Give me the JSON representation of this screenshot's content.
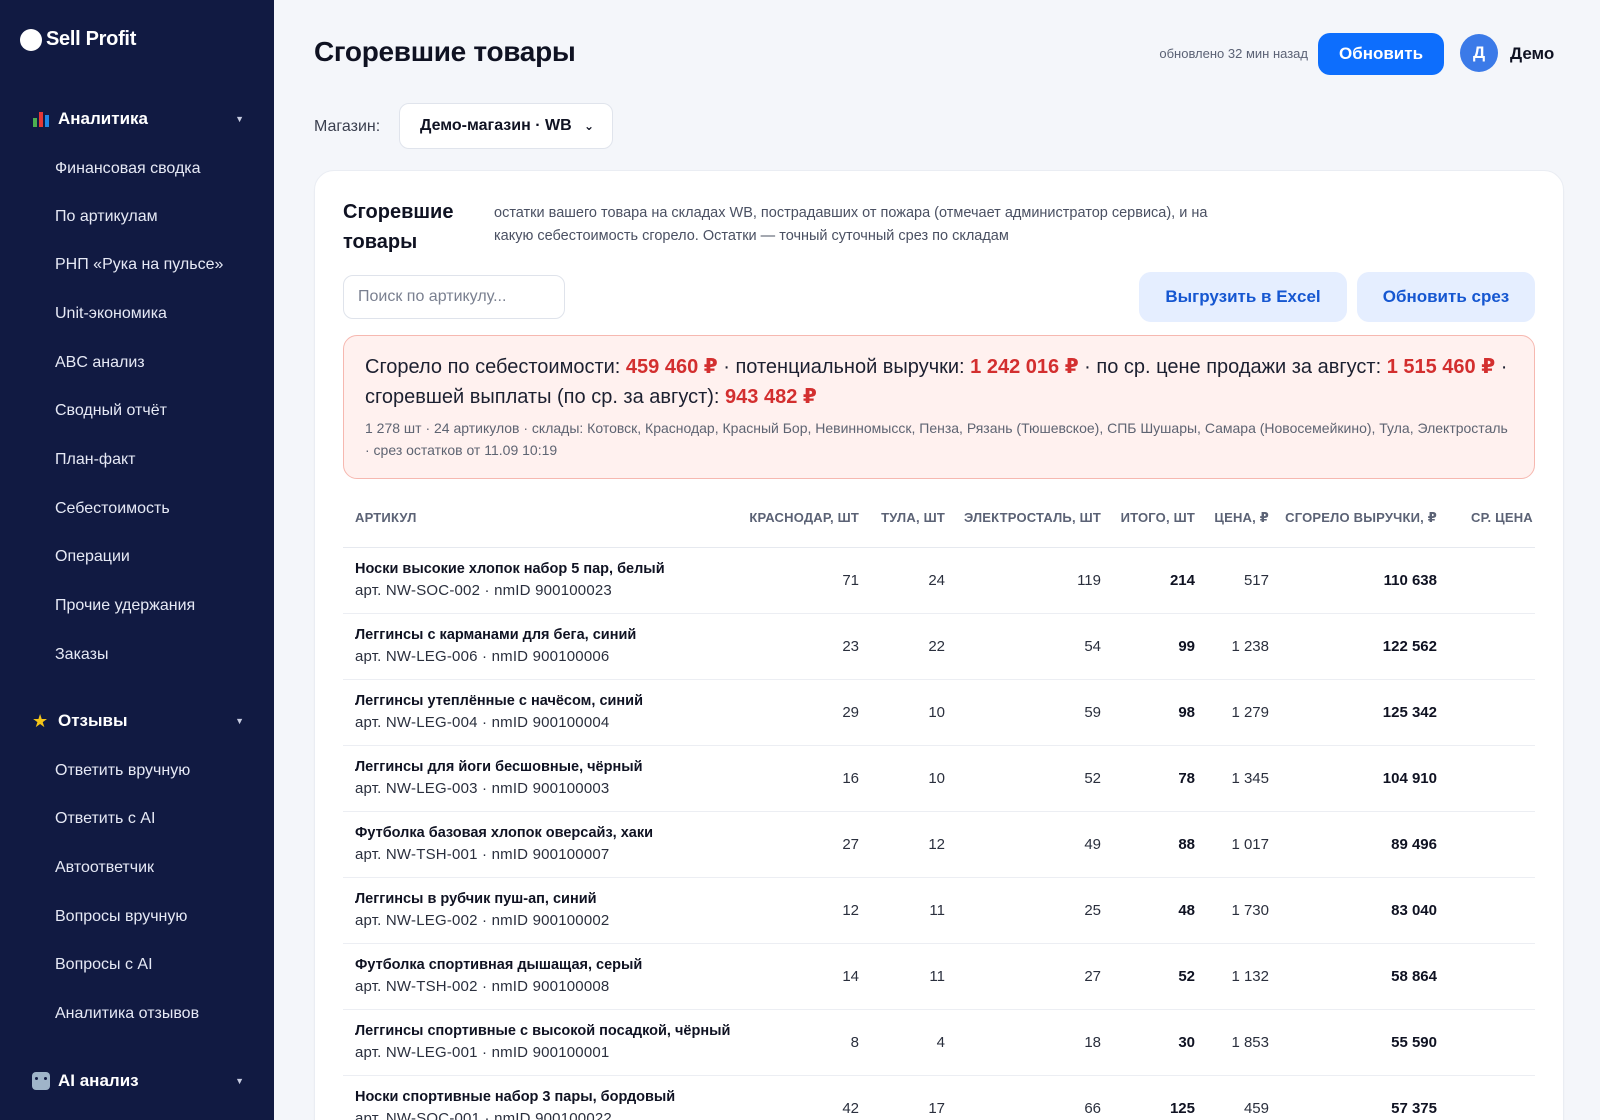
{
  "brand": {
    "name": "Sell Profit"
  },
  "sidebar": {
    "sections": [
      {
        "label": "Аналитика",
        "icon": "bar-chart-icon",
        "items": [
          "Финансовая сводка",
          "По артикулам",
          "РНП «Рука на пульсе»",
          "Unit-экономика",
          "ABC анализ",
          "Сводный отчёт",
          "План-факт",
          "Себестоимость",
          "Операции",
          "Прочие удержания",
          "Заказы"
        ]
      },
      {
        "label": "Отзывы",
        "icon": "star-icon",
        "items": [
          "Ответить вручную",
          "Ответить с AI",
          "Автоответчик",
          "Вопросы вручную",
          "Вопросы с AI",
          "Аналитика отзывов"
        ]
      },
      {
        "label": "AI анализ",
        "icon": "robot-icon",
        "items": []
      }
    ]
  },
  "header": {
    "title": "Сгоревшие товары",
    "updated": "обновлено 32 мин назад",
    "refresh_label": "Обновить",
    "avatar_letter": "Д",
    "user_name": "Демо",
    "accent_color": "#0d6efd"
  },
  "store": {
    "label": "Магазин:",
    "selected": "Демо-магазин · WB"
  },
  "card": {
    "title": "Сгоревшие товары",
    "description": "остатки вашего товара на складах WB, пострадавших от пожара (отмечает администратор сервиса), и на какую себестоимость сгорело. Остатки — точный суточный срез по складам",
    "search_placeholder": "Поиск по артикулу...",
    "excel_label": "Выгрузить в Excel",
    "slice_label": "Обновить срез"
  },
  "summary": {
    "cost_label": "Сгорело по себестоимости: ",
    "cost_value": "459 460 ₽",
    "revenue_label": " · потенциальной выручки: ",
    "revenue_value": "1 242 016 ₽",
    "avg_price_label": " · по ср. цене продажи за август: ",
    "avg_price_value": "1 515 460 ₽",
    "payout_label": " · сгоревшей выплаты (по ср. за август): ",
    "payout_value": "943 482 ₽",
    "meta": "1 278 шт · 24 артикулов · склады: Котовск, Краснодар, Красный Бор, Невинномысск, Пенза, Рязань (Тюшевское), СПБ Шушары, Самара (Новосемейкино), Тула, Электросталь · срез остатков от 11.09 10:19",
    "highlight_color": "#d32f2f"
  },
  "table": {
    "columns": [
      "Артикул",
      "Краснодар, шт",
      "Тула, шт",
      "Электросталь, шт",
      "Итого, шт",
      "Цена, ₽",
      "Сгорело выручки, ₽",
      "Ср. цена"
    ],
    "rows": [
      {
        "name": "Носки высокие хлопок набор 5 пар, белый",
        "sku": "арт. NW-SOC-002 · nmID 900100023",
        "krasnodar": "71",
        "tula": "24",
        "elektrostal": "119",
        "total": "214",
        "price": "517",
        "burned": "110 638"
      },
      {
        "name": "Леггинсы с карманами для бега, синий",
        "sku": "арт. NW-LEG-006 · nmID 900100006",
        "krasnodar": "23",
        "tula": "22",
        "elektrostal": "54",
        "total": "99",
        "price": "1 238",
        "burned": "122 562"
      },
      {
        "name": "Леггинсы утеплённые с начёсом, синий",
        "sku": "арт. NW-LEG-004 · nmID 900100004",
        "krasnodar": "29",
        "tula": "10",
        "elektrostal": "59",
        "total": "98",
        "price": "1 279",
        "burned": "125 342"
      },
      {
        "name": "Леггинсы для йоги бесшовные, чёрный",
        "sku": "арт. NW-LEG-003 · nmID 900100003",
        "krasnodar": "16",
        "tula": "10",
        "elektrostal": "52",
        "total": "78",
        "price": "1 345",
        "burned": "104 910"
      },
      {
        "name": "Футболка базовая хлопок оверсайз, хаки",
        "sku": "арт. NW-TSH-001 · nmID 900100007",
        "krasnodar": "27",
        "tula": "12",
        "elektrostal": "49",
        "total": "88",
        "price": "1 017",
        "burned": "89 496"
      },
      {
        "name": "Леггинсы в рубчик пуш-ап, синий",
        "sku": "арт. NW-LEG-002 · nmID 900100002",
        "krasnodar": "12",
        "tula": "11",
        "elektrostal": "25",
        "total": "48",
        "price": "1 730",
        "burned": "83 040"
      },
      {
        "name": "Футболка спортивная дышащая, серый",
        "sku": "арт. NW-TSH-002 · nmID 900100008",
        "krasnodar": "14",
        "tula": "11",
        "elektrostal": "27",
        "total": "52",
        "price": "1 132",
        "burned": "58 864"
      },
      {
        "name": "Леггинсы спортивные с высокой посадкой, чёрный",
        "sku": "арт. NW-LEG-001 · nmID 900100001",
        "krasnodar": "8",
        "tula": "4",
        "elektrostal": "18",
        "total": "30",
        "price": "1 853",
        "burned": "55 590"
      },
      {
        "name": "Носки спортивные набор 3 пары, бордовый",
        "sku": "арт. NW-SOC-001 · nmID 900100022",
        "krasnodar": "42",
        "tula": "17",
        "elektrostal": "66",
        "total": "125",
        "price": "459",
        "burned": "57 375"
      }
    ]
  }
}
